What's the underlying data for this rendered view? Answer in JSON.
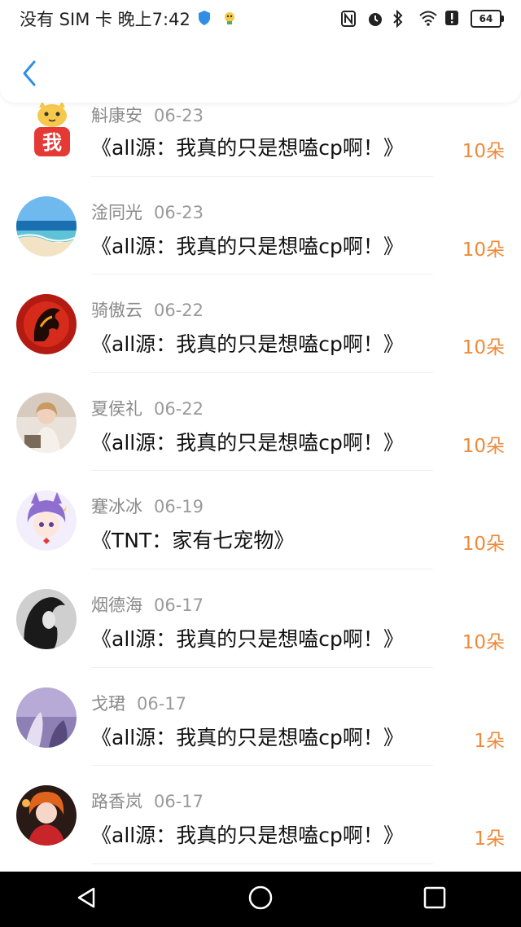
{
  "status": {
    "carrier": "没有 SIM 卡 晚上7:42",
    "battery": "64"
  },
  "items": [
    {
      "name": "斛康安",
      "date": "06-23",
      "title": "《all源：我真的只是想嗑cp啊！》",
      "amount": "10朵"
    },
    {
      "name": "淦同光",
      "date": "06-23",
      "title": "《all源：我真的只是想嗑cp啊！》",
      "amount": "10朵"
    },
    {
      "name": "骑傲云",
      "date": "06-22",
      "title": "《all源：我真的只是想嗑cp啊！》",
      "amount": "10朵"
    },
    {
      "name": "夏侯礼",
      "date": "06-22",
      "title": "《all源：我真的只是想嗑cp啊！》",
      "amount": "10朵"
    },
    {
      "name": "蹇冰冰",
      "date": "06-19",
      "title": "《TNT：家有七宠物》",
      "amount": "10朵"
    },
    {
      "name": "烟德海",
      "date": "06-17",
      "title": "《all源：我真的只是想嗑cp啊！》",
      "amount": "10朵"
    },
    {
      "name": "戈珺",
      "date": "06-17",
      "title": "《all源：我真的只是想嗑cp啊！》",
      "amount": "1朵"
    },
    {
      "name": "路香岚",
      "date": "06-17",
      "title": "《all源：我真的只是想嗑cp啊！》",
      "amount": "1朵"
    }
  ],
  "avatar_badge": "我",
  "colors": {
    "accent": "#ef8a3a",
    "back": "#2f8fe6"
  }
}
